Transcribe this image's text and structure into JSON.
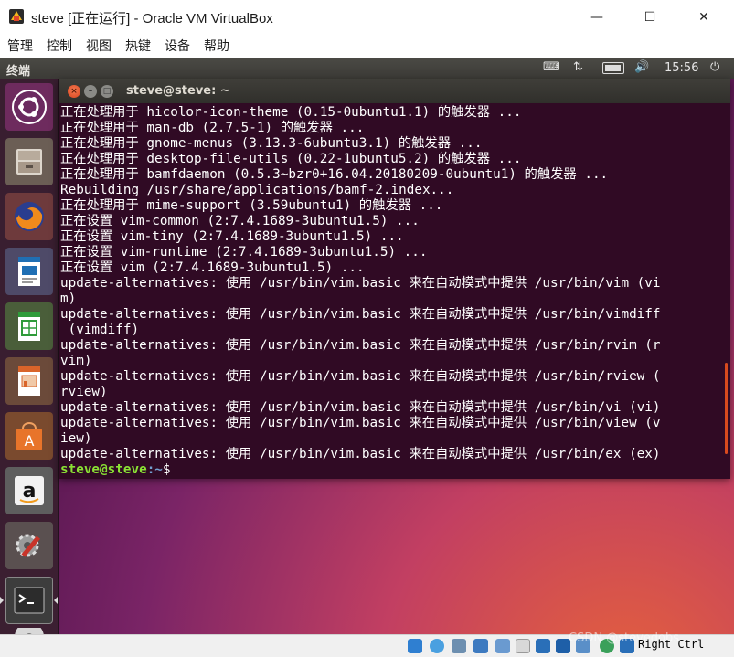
{
  "window": {
    "title": "steve [正在运行] - Oracle VM VirtualBox",
    "minimize_glyph": "—",
    "maximize_glyph": "☐",
    "close_glyph": "✕"
  },
  "menu": [
    "管理",
    "控制",
    "视图",
    "热键",
    "设备",
    "帮助"
  ],
  "guest_topbar": {
    "title": "终端",
    "clock": "15:56",
    "icons": [
      "keyboard-icon",
      "network-icon",
      "battery-icon",
      "volume-icon",
      "power-icon"
    ]
  },
  "launcher": [
    "ubuntu-dash-icon",
    "files-icon",
    "firefox-icon",
    "writer-icon",
    "calc-icon",
    "impress-icon",
    "software-center-icon",
    "amazon-icon",
    "system-settings-icon",
    "terminal-icon",
    "dvd-icon"
  ],
  "terminal": {
    "title": "steve@steve: ~",
    "lines": [
      "正在处理用于 hicolor-icon-theme (0.15-0ubuntu1.1) 的触发器 ...",
      "正在处理用于 man-db (2.7.5-1) 的触发器 ...",
      "正在处理用于 gnome-menus (3.13.3-6ubuntu3.1) 的触发器 ...",
      "正在处理用于 desktop-file-utils (0.22-1ubuntu5.2) 的触发器 ...",
      "正在处理用于 bamfdaemon (0.5.3~bzr0+16.04.20180209-0ubuntu1) 的触发器 ...",
      "Rebuilding /usr/share/applications/bamf-2.index...",
      "正在处理用于 mime-support (3.59ubuntu1) 的触发器 ...",
      "正在设置 vim-common (2:7.4.1689-3ubuntu1.5) ...",
      "正在设置 vim-tiny (2:7.4.1689-3ubuntu1.5) ...",
      "正在设置 vim-runtime (2:7.4.1689-3ubuntu1.5) ...",
      "正在设置 vim (2:7.4.1689-3ubuntu1.5) ...",
      "update-alternatives: 使用 /usr/bin/vim.basic 来在自动模式中提供 /usr/bin/vim (vi",
      "m)",
      "update-alternatives: 使用 /usr/bin/vim.basic 来在自动模式中提供 /usr/bin/vimdiff",
      " (vimdiff)",
      "update-alternatives: 使用 /usr/bin/vim.basic 来在自动模式中提供 /usr/bin/rvim (r",
      "vim)",
      "update-alternatives: 使用 /usr/bin/vim.basic 来在自动模式中提供 /usr/bin/rview (",
      "rview)",
      "update-alternatives: 使用 /usr/bin/vim.basic 来在自动模式中提供 /usr/bin/vi (vi)",
      "update-alternatives: 使用 /usr/bin/vim.basic 来在自动模式中提供 /usr/bin/view (v",
      "iew)",
      "update-alternatives: 使用 /usr/bin/vim.basic 来在自动模式中提供 /usr/bin/ex (ex)"
    ],
    "prompt_user": "steve@steve",
    "prompt_path": ":~",
    "prompt_symbol": "$"
  },
  "statusbar": {
    "watermark": "CSDN @stevedobs",
    "host_key": "Right Ctrl"
  },
  "colors": {
    "terminal_bg": "#300a24",
    "prompt_green": "#8ae234",
    "prompt_blue": "#729fcf",
    "launcher_bg": "#37202c"
  }
}
